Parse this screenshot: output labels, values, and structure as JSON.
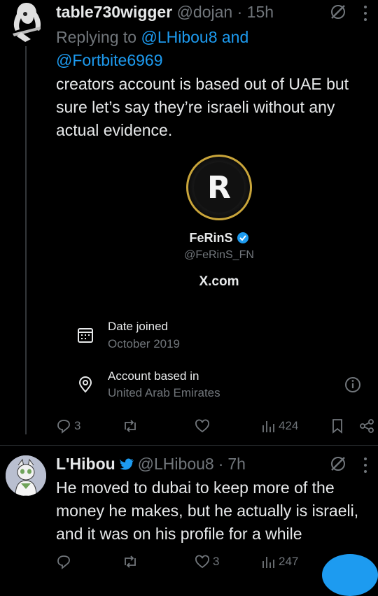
{
  "tweet1": {
    "display_name": "table730wigger",
    "handle": "@dojan",
    "separator": "·",
    "time": "15h",
    "replying_prefix": "Replying to",
    "replying_mention1": "@LHibou8",
    "replying_and": "and",
    "replying_mention2": "@Fortbite6969",
    "text": "creators account is based out of UAE but sure let’s say they’re israeli without any actual evidence.",
    "card": {
      "name": "FeRinS",
      "handle": "@FeRinS_FN",
      "site": "X.com",
      "date_joined_label": "Date joined",
      "date_joined_value": "October 2019",
      "based_in_label": "Account based in",
      "based_in_value": "United Arab Emirates"
    },
    "actions": {
      "replies": "3",
      "views": "424"
    }
  },
  "tweet2": {
    "display_name": "L'Hibou",
    "handle": "@LHibou8",
    "separator": "·",
    "time": "7h",
    "text": "He moved to dubai to keep more of the money he makes, but he actually is israeli, and it was on his profile for a while",
    "actions": {
      "likes": "3",
      "views": "247"
    }
  },
  "colors": {
    "background": "#000000",
    "text": "#e7e9ea",
    "muted": "#71767b",
    "accent": "#1d9bf0",
    "verified": "#1d9bf0"
  }
}
